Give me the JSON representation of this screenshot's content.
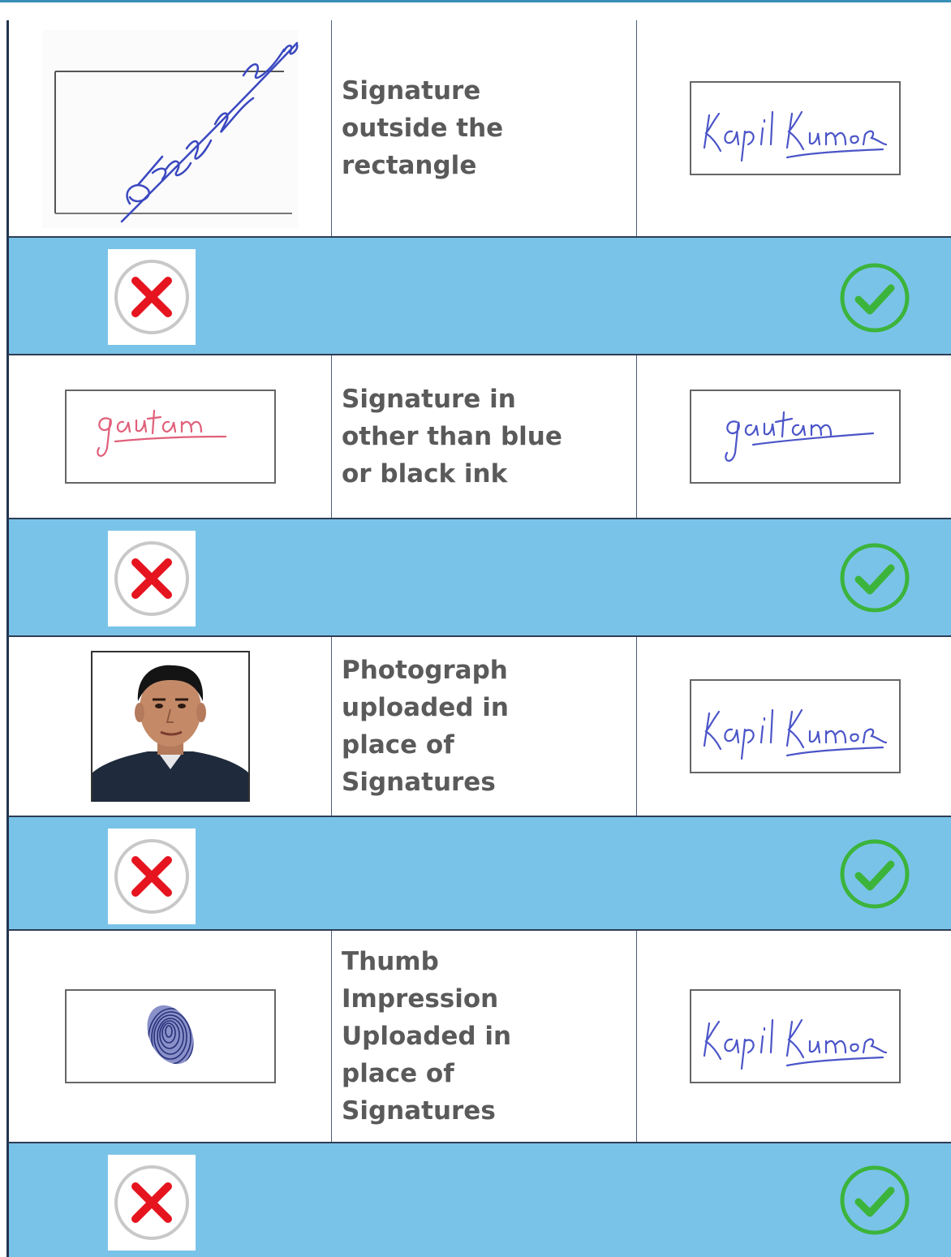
{
  "rows": [
    {
      "bad_sample": "signature-outside-rectangle",
      "label": "Signature outside the rectangle",
      "good_signature": "Kapil Kumar"
    },
    {
      "bad_sample": "red-ink-signature",
      "label": "Signature in other than blue or black ink",
      "good_signature": "gautam"
    },
    {
      "bad_sample": "photograph",
      "label": "Photograph uploaded in place of Signatures",
      "good_signature": "Kapil Kumar"
    },
    {
      "bad_sample": "thumb-impression",
      "label": "Thumb Impression Uploaded in place of Signatures",
      "good_signature": "Kapil Kumar"
    }
  ],
  "icons": {
    "reject": "x-icon",
    "accept": "check-icon"
  },
  "colors": {
    "band": "#7ac3e8",
    "reject": "#e5141f",
    "accept": "#3cb43c",
    "blue_ink": "#4b55c8",
    "red_ink": "#e0607a"
  }
}
